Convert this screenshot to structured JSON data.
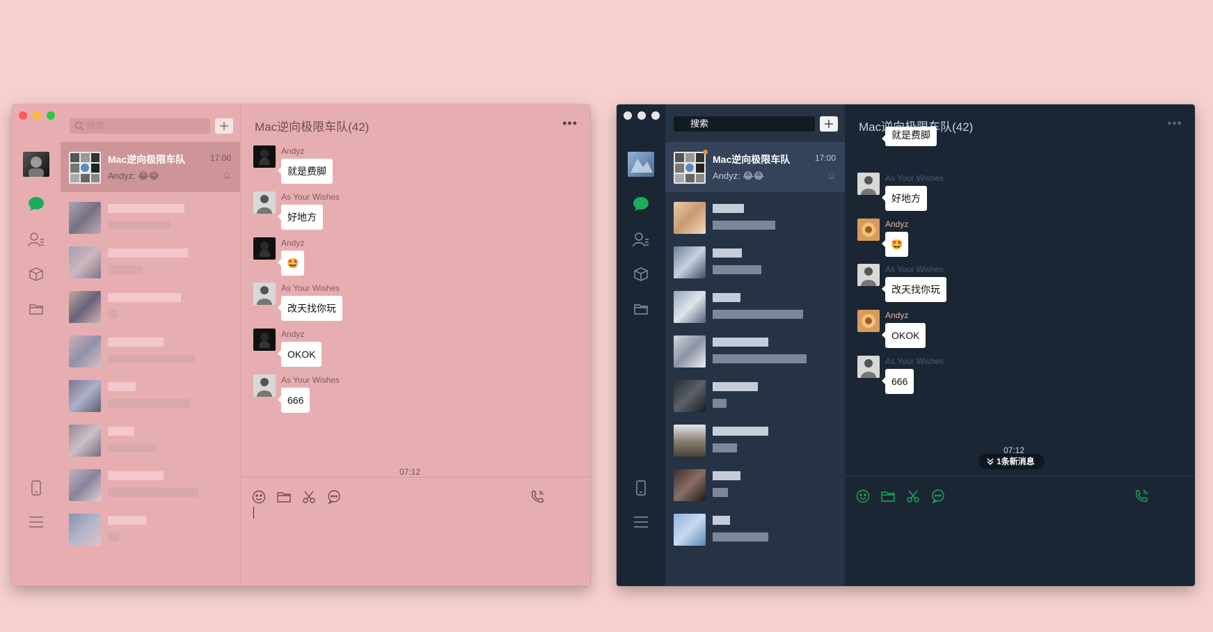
{
  "pink": {
    "search_placeholder": "搜索",
    "chat_title": "Mac逆向极限车队(42)",
    "active_conv": {
      "name": "Mac逆向极限车队",
      "time": "17:00",
      "preview": "Andyz: 😂😂"
    },
    "messages": [
      {
        "sender": "Andyz",
        "text": "就是费脚"
      },
      {
        "sender": "As Your Wishes",
        "text": "好地方"
      },
      {
        "sender": "Andyz",
        "text": "🤩"
      },
      {
        "sender": "As Your Wishes",
        "text": "改天找你玩"
      },
      {
        "sender": "Andyz",
        "text": "OKOK"
      },
      {
        "sender": "As Your Wishes",
        "text": "666"
      }
    ],
    "time_separator": "07:12",
    "colors": {
      "bg": "#e7aeb1",
      "active_row": "#cd9598",
      "text": "#ffffff",
      "muted": "#6d5257"
    }
  },
  "dark": {
    "search_placeholder": "搜索",
    "chat_title": "Mac逆向极限车队(42)",
    "active_conv": {
      "name": "Mac逆向极限车队",
      "time": "17:00",
      "preview": "Andyz: 😂😂"
    },
    "messages": [
      {
        "sender": "",
        "text": "就是费脚"
      },
      {
        "sender": "As Your Wishes",
        "text": "好地方"
      },
      {
        "sender": "Andyz",
        "text": "🤩"
      },
      {
        "sender": "As Your Wishes",
        "text": "改天找你玩"
      },
      {
        "sender": "Andyz",
        "text": "OKOK"
      },
      {
        "sender": "As Your Wishes",
        "text": "666"
      }
    ],
    "time_separator": "07:12",
    "new_message_label": "1条新消息",
    "colors": {
      "bg": "#1b2634",
      "list_bg": "#263345",
      "accent": "#1aad5b",
      "sender_andyz": "#e9b79e"
    }
  },
  "icons": {
    "rail": [
      "chat-icon",
      "contacts-icon",
      "box-icon",
      "folder-icon",
      "phone-icon",
      "menu-icon"
    ],
    "toolbar": [
      "emoji-icon",
      "folder-icon",
      "scissors-icon",
      "chat-bubble-icon",
      "voice-call-icon"
    ]
  }
}
